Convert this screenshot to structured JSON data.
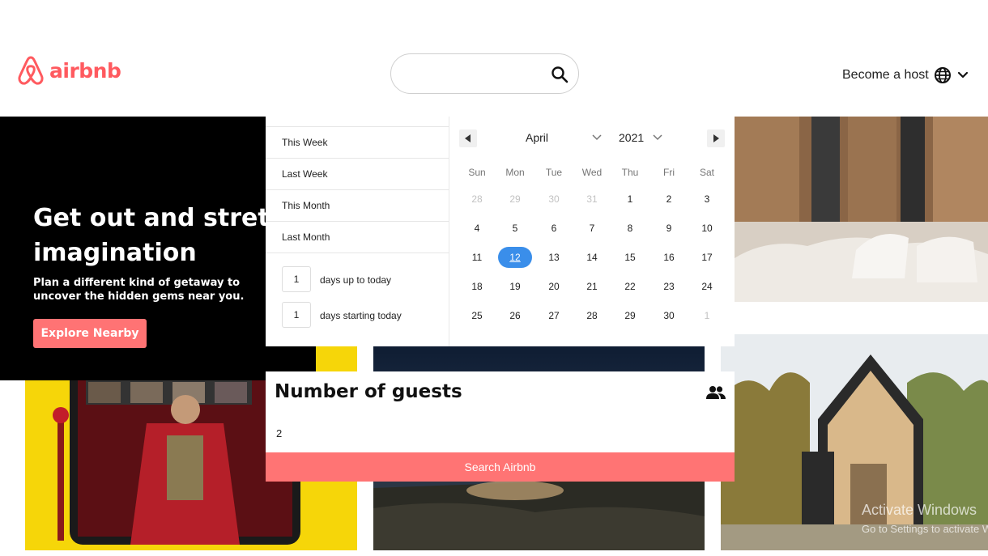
{
  "brand": {
    "name": "airbnb",
    "color": "#ff5a5f"
  },
  "header": {
    "search": {
      "value": "",
      "placeholder": ""
    },
    "host_label": "Become a host"
  },
  "hero": {
    "title": "Get out and stretch your imagination",
    "subtitle": "Plan a different kind of getaway to uncover the hidden gems near you.",
    "button_label": "Explore Nearby"
  },
  "date_picker": {
    "presets": [
      "This Week",
      "Last Week",
      "This Month",
      "Last Month"
    ],
    "ranges": [
      {
        "value": "1",
        "label": "days up to today"
      },
      {
        "value": "1",
        "label": "days starting today"
      }
    ],
    "month": "April",
    "year": "2021",
    "weekdays": [
      "Sun",
      "Mon",
      "Tue",
      "Wed",
      "Thu",
      "Fri",
      "Sat"
    ],
    "weeks": [
      [
        "28",
        "29",
        "30",
        "31",
        "1",
        "2",
        "3"
      ],
      [
        "4",
        "5",
        "6",
        "7",
        "8",
        "9",
        "10"
      ],
      [
        "11",
        "12",
        "13",
        "14",
        "15",
        "16",
        "17"
      ],
      [
        "18",
        "19",
        "20",
        "21",
        "22",
        "23",
        "24"
      ],
      [
        "25",
        "26",
        "27",
        "28",
        "29",
        "30",
        "1"
      ]
    ],
    "selected_day": "12",
    "accent": "#3a8eea"
  },
  "guests": {
    "title": "Number of guests",
    "value": "2",
    "search_button": "Search Airbnb",
    "button_color": "#ff7474"
  },
  "watermark": {
    "line1": "Activate Windows",
    "line2": "Go to Settings to activate Windows."
  }
}
